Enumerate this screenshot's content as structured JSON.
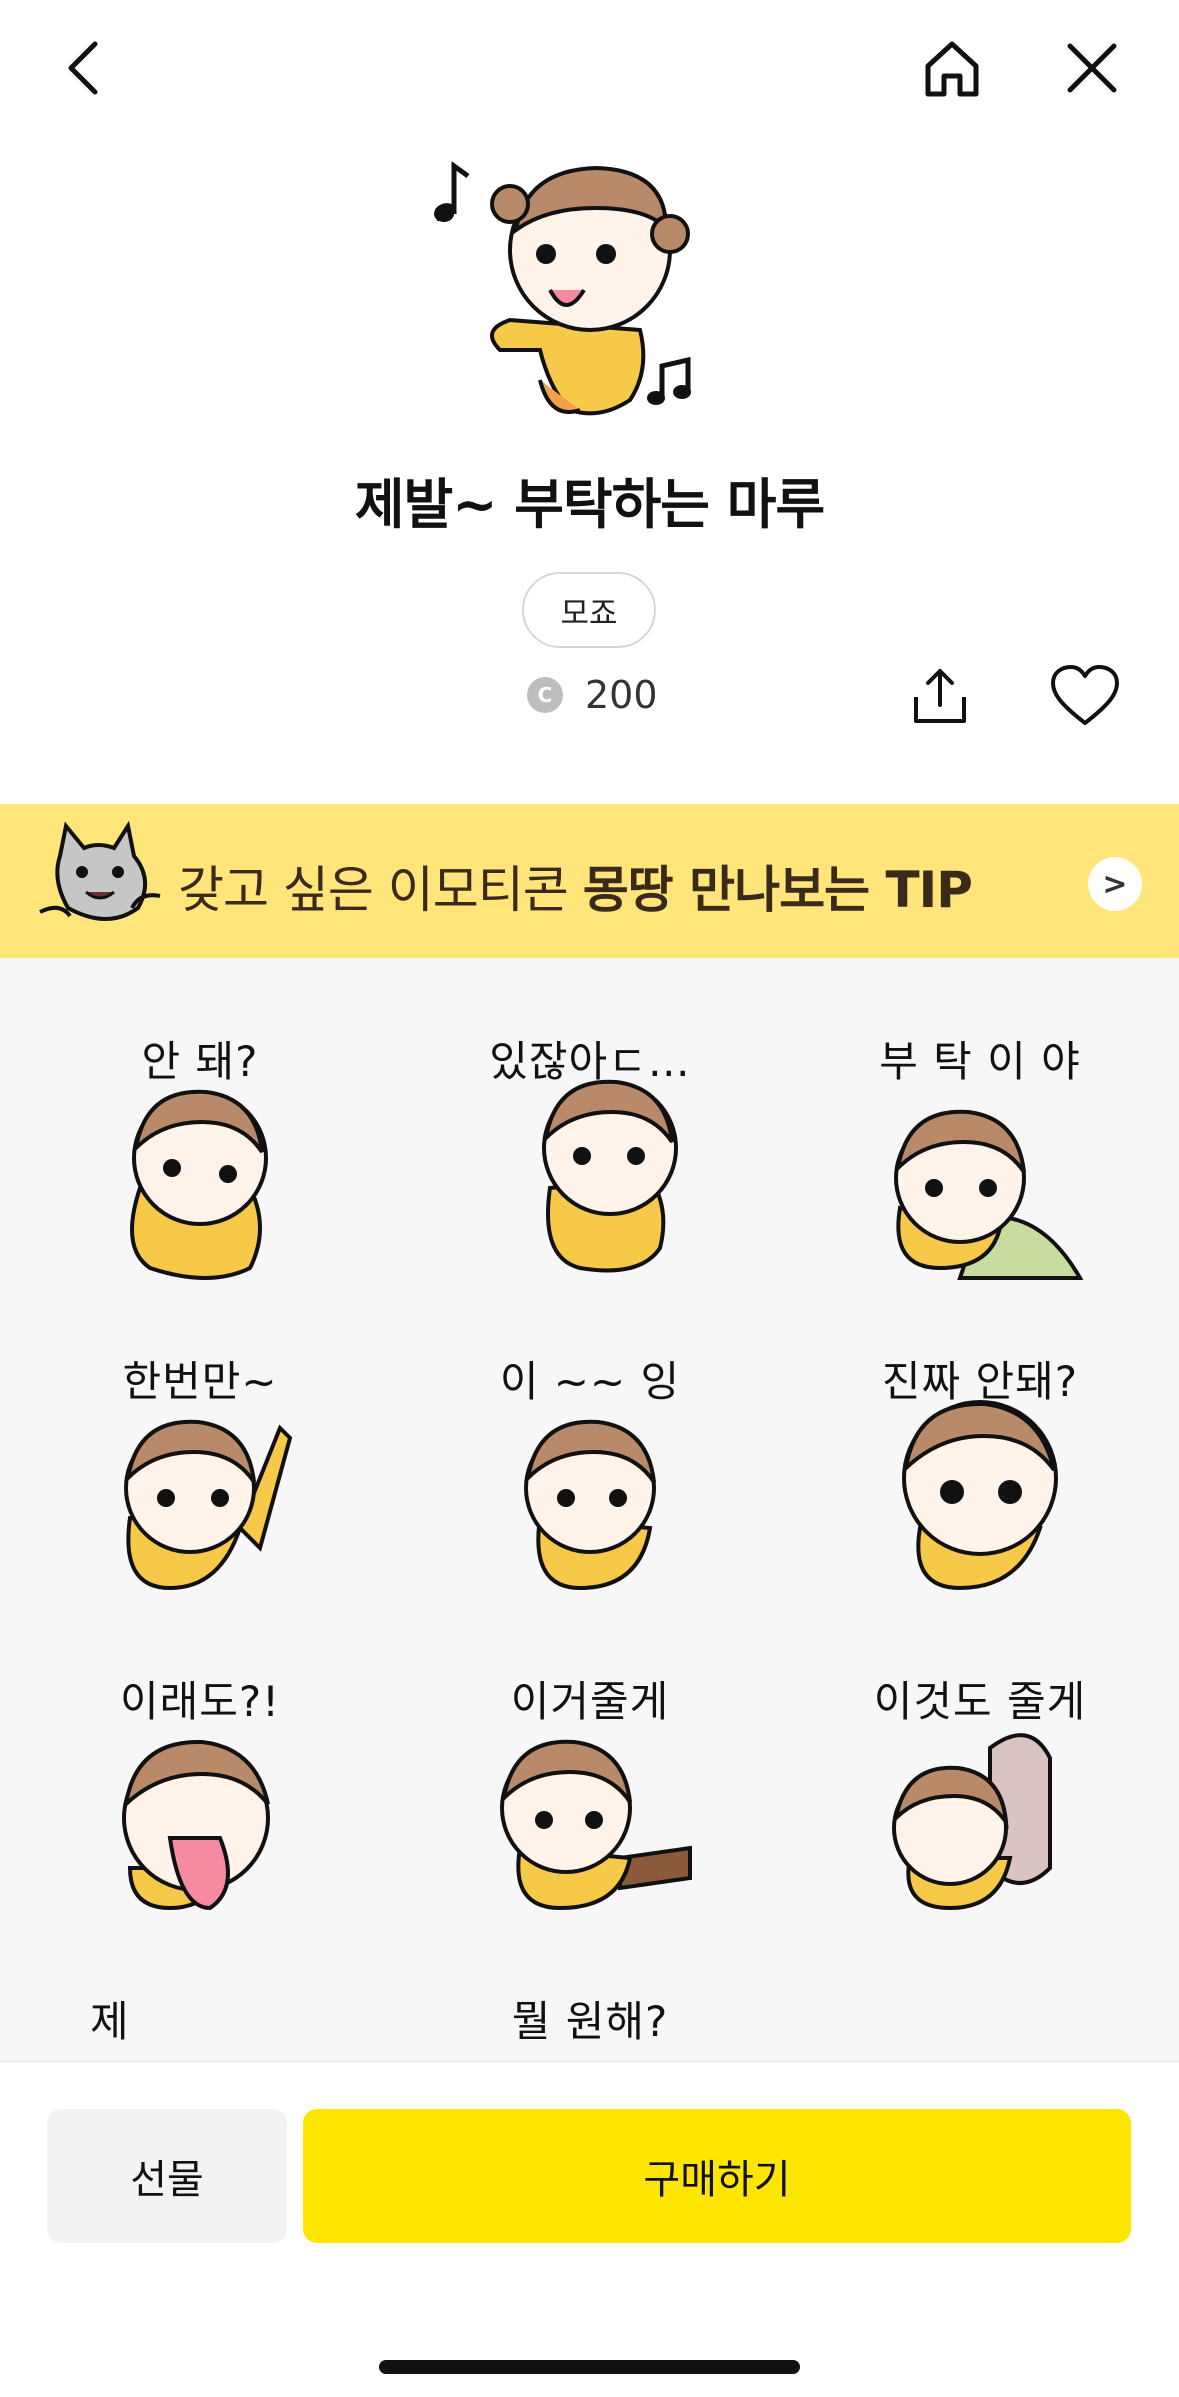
{
  "header": {
    "back_icon": "chevron-left-icon",
    "home_icon": "home-icon",
    "close_icon": "close-icon"
  },
  "product": {
    "title": "제발~ 부탁하는 마루",
    "author_tag": "모죠",
    "coin_symbol": "C",
    "price": "200",
    "share_icon": "share-icon",
    "like_icon": "heart-icon"
  },
  "banner": {
    "text_regular": "갖고 싶은 이모티콘 ",
    "text_bold": "몽땅 만나보는 TIP",
    "arrow": ">"
  },
  "stickers": [
    {
      "caption": "안      돼?"
    },
    {
      "caption": "있잖아ㄷ…"
    },
    {
      "caption": "부 탁 이 야"
    },
    {
      "caption": "한번만~"
    },
    {
      "caption": "이 ~~ 잉"
    },
    {
      "caption": "진짜 안돼?"
    },
    {
      "caption": "이래도?!"
    },
    {
      "caption": "이거줄게"
    },
    {
      "caption": "이것도 줄게"
    },
    {
      "caption": "제"
    },
    {
      "caption": "뭘 원해?"
    },
    {
      "caption": ""
    }
  ],
  "footer": {
    "gift_label": "선물",
    "buy_label": "구매하기"
  },
  "colors": {
    "banner_bg": "#ffe57a",
    "buy_bg": "#ffe600",
    "grid_bg": "#f7f7f7",
    "character_hair": "#b98a6a",
    "character_shirt": "#f7c948"
  }
}
